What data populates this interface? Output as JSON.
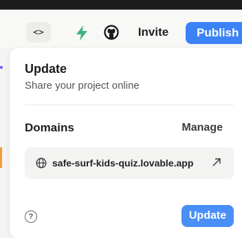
{
  "toolbar": {
    "code_icon_glyph": "<>",
    "invite_label": "Invite",
    "publish_label": "Publish",
    "publish_color": "#3b82f6"
  },
  "panel": {
    "title": "Update",
    "subtitle": "Share your project online",
    "domains_heading": "Domains",
    "manage_label": "Manage",
    "domain": "safe-surf-kids-quiz.lovable.app",
    "help_glyph": "?",
    "update_label": "Update",
    "update_color": "#4a8ff7"
  },
  "icons": [
    "code-icon",
    "bolt-icon",
    "github-icon",
    "globe-icon",
    "external-link-icon",
    "help-icon"
  ]
}
